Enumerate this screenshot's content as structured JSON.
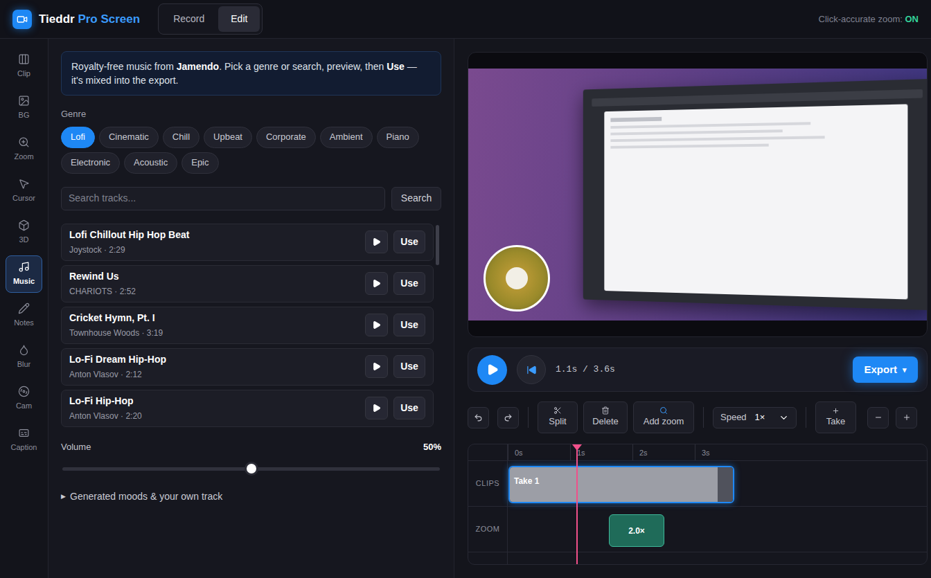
{
  "app": {
    "name": "Tieddr",
    "name_accent": "Pro Screen"
  },
  "mode_tabs": [
    {
      "label": "Record",
      "selected": false
    },
    {
      "label": "Edit",
      "selected": true
    }
  ],
  "status": {
    "label": "Click-accurate zoom:",
    "value": "ON",
    "on": true
  },
  "sidebar": {
    "items": [
      {
        "label": "Clip",
        "selected": false
      },
      {
        "label": "BG",
        "selected": false
      },
      {
        "label": "Zoom",
        "selected": false
      },
      {
        "label": "Cursor",
        "selected": false
      },
      {
        "label": "3D",
        "selected": false
      },
      {
        "label": "Music",
        "selected": true
      },
      {
        "label": "Notes",
        "selected": false
      },
      {
        "label": "Blur",
        "selected": false
      },
      {
        "label": "Cam",
        "selected": false
      },
      {
        "label": "Caption",
        "selected": false
      }
    ]
  },
  "music_panel": {
    "info": {
      "before": "Royalty-free music from ",
      "source": "Jamendo",
      "middle": ". Pick a genre or search, preview, then ",
      "action": "Use",
      "after": " — it's mixed into the export."
    },
    "genre_label": "Genre",
    "genres": [
      {
        "label": "Lofi",
        "selected": true
      },
      {
        "label": "Cinematic",
        "selected": false
      },
      {
        "label": "Chill",
        "selected": false
      },
      {
        "label": "Upbeat",
        "selected": false
      },
      {
        "label": "Corporate",
        "selected": false
      },
      {
        "label": "Ambient",
        "selected": false
      },
      {
        "label": "Piano",
        "selected": false
      },
      {
        "label": "Electronic",
        "selected": false
      },
      {
        "label": "Acoustic",
        "selected": false
      },
      {
        "label": "Epic",
        "selected": false
      }
    ],
    "search": {
      "placeholder": "Search tracks...",
      "button": "Search"
    },
    "tracks": [
      {
        "title": "Lofi Chillout Hip Hop Beat",
        "meta": "Joystock · 2:29",
        "use": "Use"
      },
      {
        "title": "Rewind Us",
        "meta": "CHARIOTS · 2:52",
        "use": "Use"
      },
      {
        "title": "Cricket Hymn, Pt. I",
        "meta": "Townhouse Woods · 3:19",
        "use": "Use"
      },
      {
        "title": "Lo-Fi Dream Hip-Hop",
        "meta": "Anton Vlasov · 2:12",
        "use": "Use"
      },
      {
        "title": "Lo-Fi Hip-Hop",
        "meta": "Anton Vlasov · 2:20",
        "use": "Use"
      }
    ],
    "volume": {
      "label": "Volume",
      "reading": "50%",
      "level": 0.5
    },
    "more": {
      "icon": "▶",
      "label": "Generated moods & your own track",
      "expanded": false
    }
  },
  "player": {
    "time": "1.1s / 3.6s",
    "export": "Export",
    "export_icon": "▾"
  },
  "toolbar": {
    "buttons": [
      {
        "label": "Split"
      },
      {
        "label": "Delete"
      },
      {
        "label": "Add zoom"
      }
    ],
    "speed": {
      "label": "Speed",
      "value": "1×"
    },
    "take": {
      "label": "Take"
    }
  },
  "timeline": {
    "ticks": [
      "0s",
      "1s",
      "2s",
      "3s"
    ],
    "lanes": [
      {
        "label": "CLIPS"
      },
      {
        "label": "ZOOM"
      }
    ],
    "clip": {
      "label": "Take 1",
      "selected": true
    },
    "zoom_block": {
      "label": "2.0×"
    }
  }
}
